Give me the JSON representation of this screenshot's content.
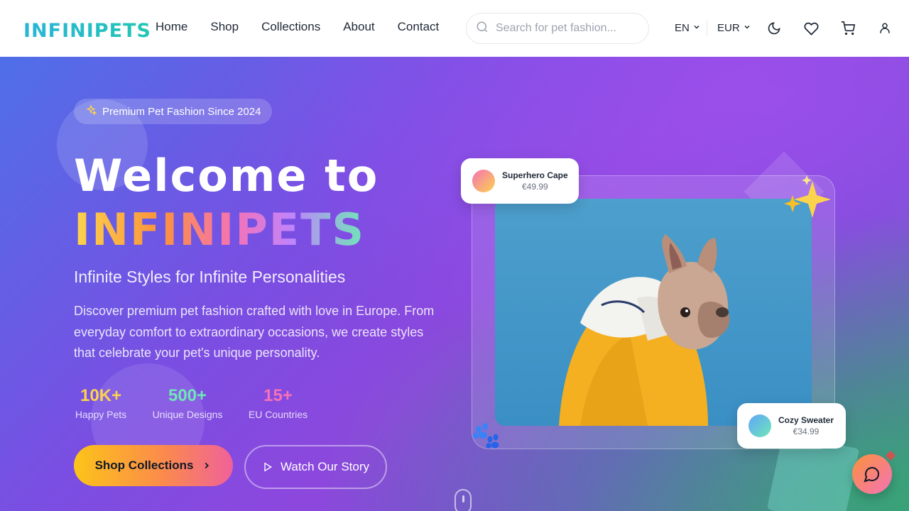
{
  "header": {
    "logo": "INFINIPETS",
    "nav": [
      "Home",
      "Shop",
      "Collections",
      "About",
      "Contact"
    ],
    "search_placeholder": "Search for pet fashion...",
    "language": "EN",
    "currency": "EUR"
  },
  "hero": {
    "badge": "Premium Pet Fashion Since 2024",
    "title_line1": "Welcome to",
    "title_line2": "INFINIPETS",
    "subtitle": "Infinite Styles for Infinite Personalities",
    "description": "Discover premium pet fashion crafted with love in Europe. From everyday comfort to extraordinary occasions, we create styles that celebrate your pet's unique personality.",
    "stats": [
      {
        "value": "10K+",
        "label": "Happy Pets",
        "color": "#fcd34d"
      },
      {
        "value": "500+",
        "label": "Unique Designs",
        "color": "#6ee7b7"
      },
      {
        "value": "15+",
        "label": "EU Countries",
        "color": "#f472b6"
      }
    ],
    "cta_primary": "Shop Collections",
    "cta_secondary": "Watch Our Story"
  },
  "product_cards": [
    {
      "name": "Superhero Cape",
      "price": "€49.99"
    },
    {
      "name": "Cozy Sweater",
      "price": "€34.99"
    }
  ],
  "icons": [
    "search-icon",
    "chevron-down-icon",
    "moon-icon",
    "heart-icon",
    "cart-icon",
    "user-icon",
    "sparkles-icon",
    "chevron-right-icon",
    "play-icon",
    "paw-icon",
    "chat-icon"
  ]
}
